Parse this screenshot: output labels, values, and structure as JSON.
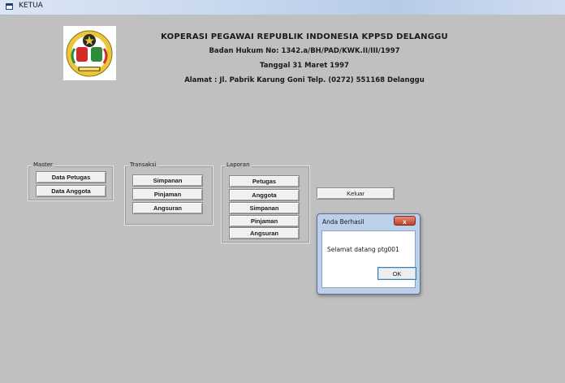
{
  "window": {
    "title": "KETUA"
  },
  "header": {
    "line1": "KOPERASI PEGAWAI REPUBLIK INDONESIA KPPSD DELANGGU",
    "line2": "Badan Hukum No: 1342.a/BH/PAD/KWK.II/III/1997",
    "line3": "Tanggal 31 Maret 1997",
    "line4": "Alamat : Jl. Pabrik Karung Goni   Telp. (0272) 551168 Delanggu"
  },
  "groups": {
    "master": {
      "label": "Master",
      "buttons": [
        "Data Petugas",
        "Data Anggota"
      ]
    },
    "transaksi": {
      "label": "Transaksi",
      "buttons": [
        "Simpanan",
        "Pinjaman",
        "Angsuran"
      ]
    },
    "laporan": {
      "label": "Laporan",
      "buttons": [
        "Petugas",
        "Anggota",
        "Simpanan",
        "Pinjaman",
        "Angsuran"
      ]
    }
  },
  "keluar_label": "Keluar",
  "dialog": {
    "title": "Anda Berhasil",
    "close_label": "x",
    "message": "Selamat datang ptg001",
    "ok_label": "OK"
  },
  "colors": {
    "form_bg": "#c0c0c0",
    "logo_green": "#2e8b3a",
    "logo_red": "#d42a2a"
  }
}
